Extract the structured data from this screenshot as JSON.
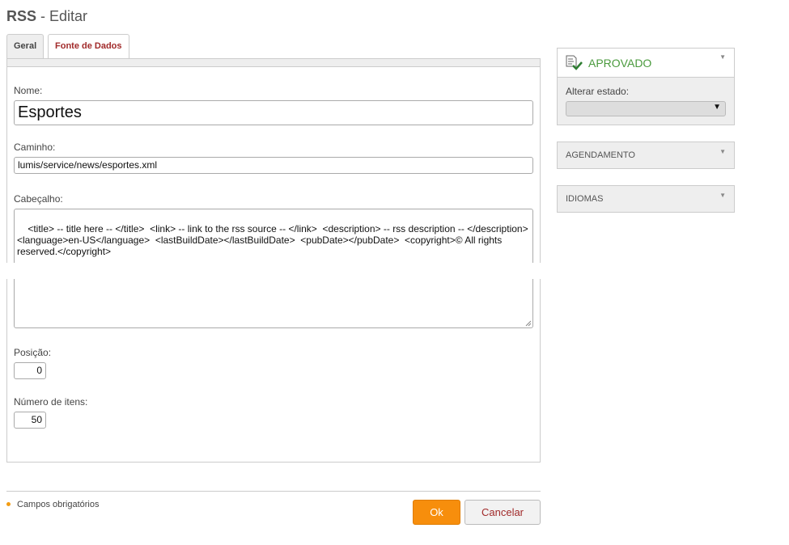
{
  "page": {
    "title_bold": "RSS",
    "title_rest": " - Editar"
  },
  "tabs": [
    {
      "label": "Geral",
      "active": true
    },
    {
      "label": "Fonte de Dados",
      "active": false
    }
  ],
  "form": {
    "nome_label": "Nome:",
    "nome_value": "Esportes",
    "caminho_label": "Caminho:",
    "caminho_value": "lumis/service/news/esportes.xml",
    "cabecalho_label": "Cabeçalho:",
    "cabecalho_value": "<title> -- title here -- </title>  <link> -- link to the rss source -- </link>  <description> -- rss description -- </description>\n<language>en-US</language>  <lastBuildDate></lastBuildDate>  <pubDate></pubDate>  <copyright>© All rights\nreserved.</copyright>",
    "posicao_label": "Posição:",
    "posicao_value": "0",
    "numero_label": "Número de itens:",
    "numero_value": "50"
  },
  "footer": {
    "required_note": "Campos obrigatórios",
    "ok_label": "Ok",
    "cancel_label": "Cancelar"
  },
  "sidebar": {
    "status": {
      "title": "APROVADO",
      "change_label": "Alterar estado:",
      "select_value": ""
    },
    "scheduling_title": "AGENDAMENTO",
    "languages_title": "IDIOMAS"
  },
  "colors": {
    "accent": "#f78e0c",
    "status_green": "#4a9a3d",
    "link_red": "#a12a2a"
  }
}
